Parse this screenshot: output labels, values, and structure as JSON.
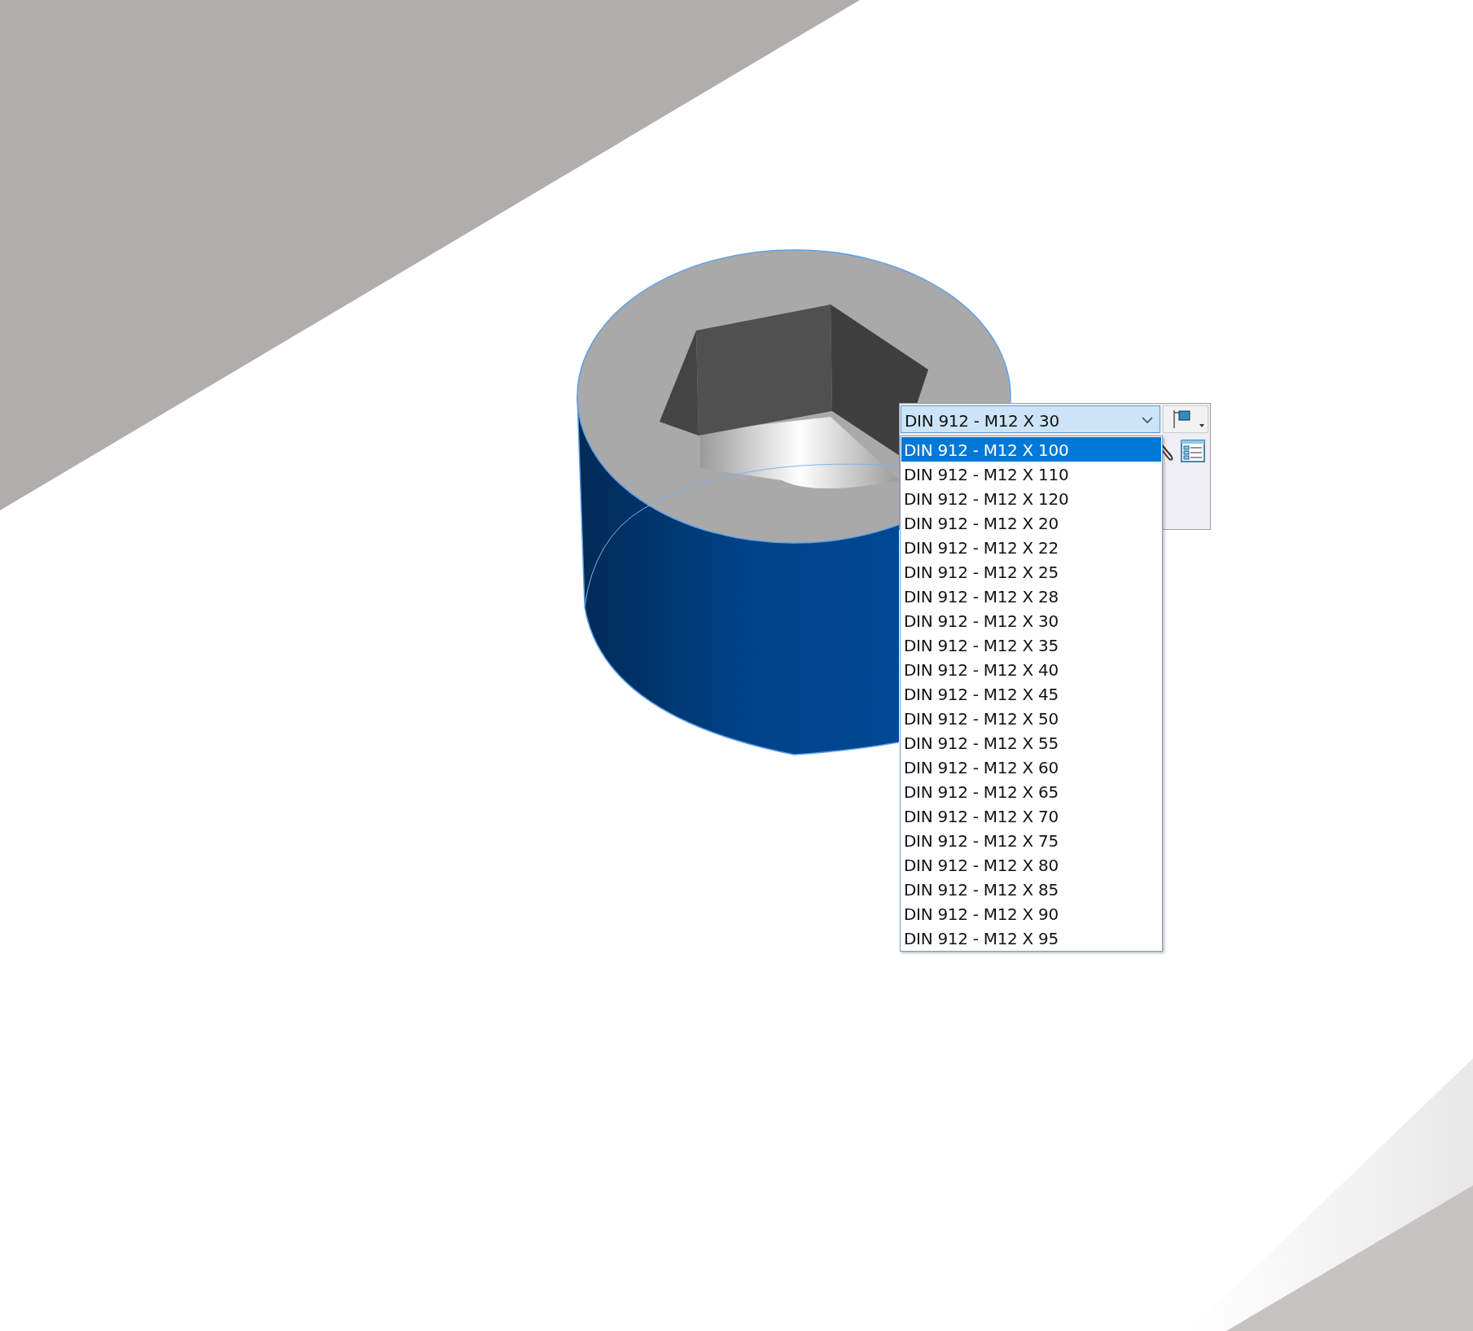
{
  "configuration_combo": {
    "value": "DIN 912 - M12 X 30",
    "expanded": true
  },
  "dropdown_items": [
    {
      "label": "DIN 912 - M12 X 100",
      "selected": true
    },
    {
      "label": "DIN 912 - M12 X 110",
      "selected": false
    },
    {
      "label": "DIN 912 - M12 X 120",
      "selected": false
    },
    {
      "label": "DIN 912 - M12 X 20",
      "selected": false
    },
    {
      "label": "DIN 912 - M12 X 22",
      "selected": false
    },
    {
      "label": "DIN 912 - M12 X 25",
      "selected": false
    },
    {
      "label": "DIN 912 - M12 X 28",
      "selected": false
    },
    {
      "label": "DIN 912 - M12 X 30",
      "selected": false
    },
    {
      "label": "DIN 912 - M12 X 35",
      "selected": false
    },
    {
      "label": "DIN 912 - M12 X 40",
      "selected": false
    },
    {
      "label": "DIN 912 - M12 X 45",
      "selected": false
    },
    {
      "label": "DIN 912 - M12 X 50",
      "selected": false
    },
    {
      "label": "DIN 912 - M12 X 55",
      "selected": false
    },
    {
      "label": "DIN 912 - M12 X 60",
      "selected": false
    },
    {
      "label": "DIN 912 - M12 X 65",
      "selected": false
    },
    {
      "label": "DIN 912 - M12 X 70",
      "selected": false
    },
    {
      "label": "DIN 912 - M12 X 75",
      "selected": false
    },
    {
      "label": "DIN 912 - M12 X 80",
      "selected": false
    },
    {
      "label": "DIN 912 - M12 X 85",
      "selected": false
    },
    {
      "label": "DIN 912 - M12 X 90",
      "selected": false
    },
    {
      "label": "DIN 912 - M12 X 95",
      "selected": false
    }
  ]
}
